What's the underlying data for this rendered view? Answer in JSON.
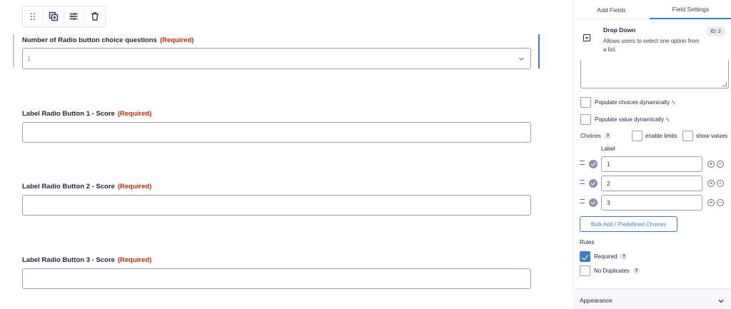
{
  "toolbar": {
    "icons": [
      "drag-handle-icon",
      "duplicate-icon",
      "settings-sliders-icon",
      "trash-icon"
    ]
  },
  "form": {
    "required_text": "(Required)",
    "fields": [
      {
        "label": "Number of Radio button choice questions",
        "type": "select",
        "value": "1"
      },
      {
        "label": "Label Radio Button 1 - Score",
        "type": "text",
        "value": ""
      },
      {
        "label": "Label Radio Button 2 - Score",
        "type": "text",
        "value": ""
      },
      {
        "label": "Label Radio Button 3 - Score",
        "type": "text",
        "value": ""
      }
    ]
  },
  "panel": {
    "tabs": [
      {
        "label": "Add Fields",
        "active": false
      },
      {
        "label": "Field Settings",
        "active": true
      }
    ],
    "field_info": {
      "title": "Drop Down",
      "description": "Allows users to select one option from a list.",
      "id_badge": "ID: 2"
    },
    "populate_choices": {
      "label": "Populate choices dynamically",
      "checked": false
    },
    "populate_value": {
      "label": "Populate value dynamically",
      "checked": false
    },
    "choices": {
      "label": "Choices",
      "help": "?",
      "enable_limits": "enable limits",
      "show_values": "show values",
      "column_label": "Label",
      "items": [
        "1",
        "2",
        "3"
      ],
      "add_symbol": "+",
      "remove_symbol": "−"
    },
    "bulk_button": "Bulk Add / Predefined Choices",
    "rules": {
      "title": "Rules",
      "required": {
        "label": "Required",
        "checked": true,
        "help": "?"
      },
      "no_duplicates": {
        "label": "No Duplicates",
        "checked": false,
        "help": "?"
      }
    },
    "appearance": {
      "label": "Appearance"
    }
  },
  "colors": {
    "accent": "#3e7fc1",
    "required": "#c02b0a",
    "text": "#242748"
  }
}
